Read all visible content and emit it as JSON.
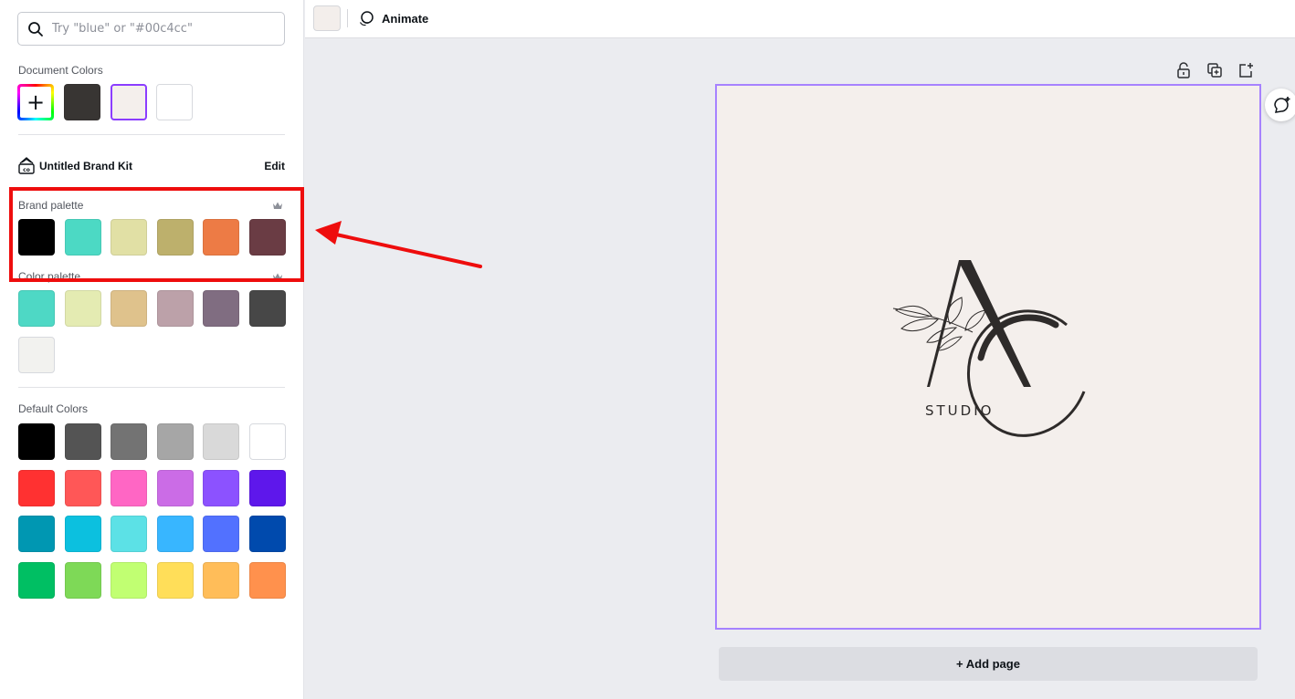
{
  "search": {
    "placeholder": "Try \"blue\" or \"#00c4cc\""
  },
  "document_colors": {
    "label": "Document Colors",
    "add_icon": "plus-icon",
    "swatches": [
      "#383533",
      "#f4efec",
      "#ffffff"
    ],
    "selected": "#f4efec"
  },
  "brand_kit": {
    "icon": "brand-kit-icon",
    "name": "Untitled Brand Kit",
    "edit_label": "Edit"
  },
  "brand_palette": {
    "label": "Brand palette",
    "swatches": [
      "#000000",
      "#4cd9c4",
      "#e1e0a5",
      "#bdb06c",
      "#ed7b45",
      "#6a3c44"
    ]
  },
  "color_palette": {
    "label": "Color palette",
    "swatches": [
      "#4ed8c5",
      "#e4ebb2",
      "#dfc28c",
      "#bca1a9",
      "#806d81",
      "#474747",
      "#f2f2ef"
    ]
  },
  "default_colors": {
    "label": "Default Colors",
    "swatches": [
      "#000000",
      "#545454",
      "#737373",
      "#a6a6a6",
      "#d9d9d9",
      "#ffffff",
      "#ff3131",
      "#ff5757",
      "#ff66c4",
      "#cb6ce6",
      "#8c52ff",
      "#5e17eb",
      "#0097b2",
      "#0cc0df",
      "#5ce1e6",
      "#38b6ff",
      "#5271ff",
      "#004aad",
      "#00bf63",
      "#7ed957",
      "#c1ff72",
      "#ffde59",
      "#ffbd59",
      "#ff914d"
    ]
  },
  "toolbar": {
    "background_color": "#f3eeeb",
    "animate_label": "Animate",
    "animate_icon": "animate-icon"
  },
  "page_tools": [
    "lock-icon",
    "duplicate-page-icon",
    "add-page-icon"
  ],
  "design": {
    "background": "#f4efec",
    "logo_letters": "AC",
    "logo_text": "STUDIO",
    "ink_color": "#2e2b2a"
  },
  "comment_button": {
    "icon": "comment-icon"
  },
  "add_page_label": "+ Add page",
  "annotation": {
    "color": "#ee0d0d"
  }
}
